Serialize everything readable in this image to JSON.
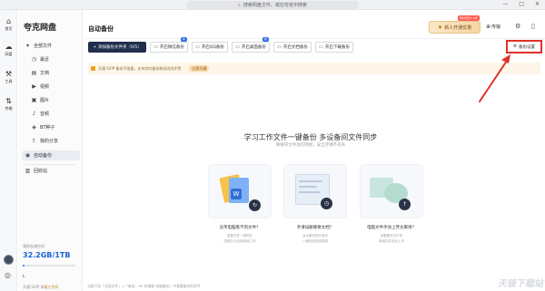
{
  "titlebar": {
    "search_placeholder": "搜索网盘文件、或在夸克中搜索",
    "search_icon": "search-icon",
    "win_controls": [
      "—",
      "□",
      "✕"
    ]
  },
  "rail": {
    "items": [
      {
        "label": "首页",
        "icon": "home-icon"
      },
      {
        "label": "网盘",
        "icon": "cloud-icon"
      },
      {
        "label": "工具",
        "icon": "tools-icon"
      },
      {
        "label": "传输",
        "icon": "transfer-icon"
      }
    ]
  },
  "sidebar": {
    "brand": "夸克网盘",
    "items": [
      {
        "label": "全部文件",
        "icon": "folder-icon"
      },
      {
        "label": "最近",
        "icon": "clock-icon"
      },
      {
        "label": "文档",
        "icon": "doc-icon"
      },
      {
        "label": "视频",
        "icon": "video-icon"
      },
      {
        "label": "图片",
        "icon": "image-icon"
      },
      {
        "label": "音频",
        "icon": "music-icon"
      },
      {
        "label": "BT种子",
        "icon": "bt-icon"
      },
      {
        "label": "我的分享",
        "icon": "share-icon"
      },
      {
        "label": "自动备份",
        "icon": "backup-icon"
      },
      {
        "label": "回收站",
        "icon": "trash-icon"
      }
    ],
    "storage_label": "我的存储空间",
    "storage_value": "32.2GB/1TB",
    "storage_fraction": 0.032,
    "user_short": "L",
    "upgrade_tip_prefix": "开通 SVIP 享",
    "upgrade_tip_link": "最大空间"
  },
  "header": {
    "title": "自动备份",
    "member_label": "新人开通优惠",
    "member_tag": "限时低至5.5折",
    "transfer_label": "传输",
    "gear_icon": "gear-icon",
    "phone_icon": "phone-icon"
  },
  "toolbar": {
    "add_folder": "添加备份文件夹（0/5）",
    "chips": [
      {
        "label": "开启微信备份",
        "tag": ""
      },
      {
        "label": "开启QQ备份",
        "tag": "新"
      },
      {
        "label": "开启桌面备份",
        "tag": "新"
      },
      {
        "label": "开启文档备份",
        "tag": ""
      },
      {
        "label": "开启下载备份",
        "tag": ""
      }
    ],
    "settings": "备份设置"
  },
  "notice": {
    "text": "开通 SVIP 备份不限量，支持实时备份和双向同步等",
    "button": "立即开通"
  },
  "hero": {
    "title": "学习工作文件一键备份 多设备间文件同步",
    "subtitle": "重要的文件放在网盘，安全存储不丢失"
  },
  "cards": [
    {
      "title": "没带电脑看不到文件？",
      "desc1": "重要文件一键同步",
      "desc2": "回家办公也能继续工作"
    },
    {
      "title": "手滑误删重要文档？",
      "desc1": "自动备份历史版本",
      "desc2": "一键轻松找回数据"
    },
    {
      "title": "电脑文件手动上传太麻烦？",
      "desc1": "设置备份文件夹",
      "desc2": "新增文件自动上传"
    }
  ],
  "footer": {
    "text": "当前只在「全部文件」>「来自：HP 的电脑 电脑备份」中查看备份的文件"
  },
  "watermark": "天极下载站",
  "colors": {
    "primary_dark": "#1f2f4d",
    "accent_blue": "#2d6be2",
    "annotation_red": "#e0302a",
    "member_gold": "#f4d6a5"
  }
}
